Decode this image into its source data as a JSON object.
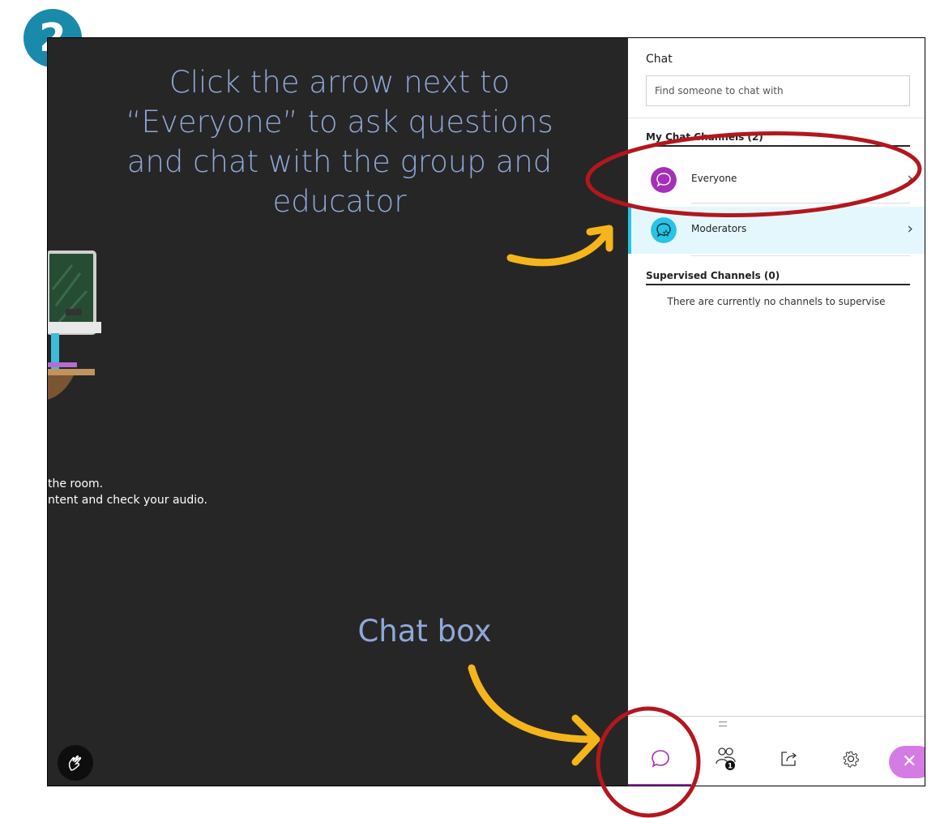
{
  "step_badge": "2",
  "instruction_text": "Click the arrow next to “Everyone” to ask questions and chat with the group and educator",
  "chatbox_label": "Chat box",
  "stage_text": {
    "line1": "the room.",
    "line2": "ntent and check your audio."
  },
  "panel": {
    "title": "Chat",
    "search_placeholder": "Find someone to chat with",
    "my_channels_header": "My Chat Channels (2)",
    "channels": [
      {
        "label": "Everyone",
        "icon": "chat-bubble-icon",
        "color": "#a52fb8"
      },
      {
        "label": "Moderators",
        "icon": "star-bubble-icon",
        "color": "#27c3e8"
      }
    ],
    "supervised_header": "Supervised Channels (0)",
    "supervised_empty": "There are currently no channels to supervise"
  },
  "bottom_bar": {
    "participants_count": "1",
    "tabs": [
      "chat-icon",
      "participants-icon",
      "share-content-icon",
      "settings-icon",
      "close-icon"
    ]
  },
  "colors": {
    "annotation_text": "#8fa8d8",
    "arrow": "#f6b51b",
    "highlight_circle": "#b3171d",
    "badge": "#1a8aab",
    "accent_purple": "#a52fb8",
    "accent_cyan": "#27c3e8"
  }
}
